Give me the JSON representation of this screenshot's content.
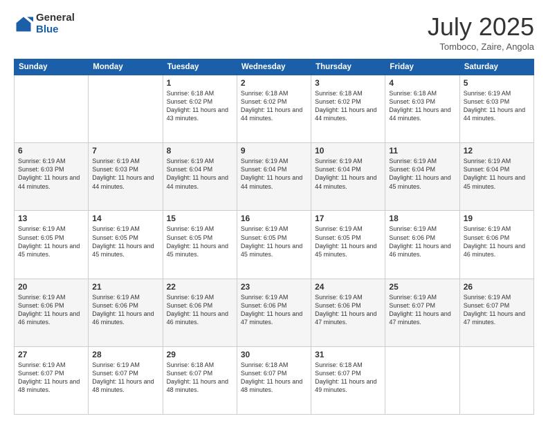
{
  "header": {
    "logo_general": "General",
    "logo_blue": "Blue",
    "month_title": "July 2025",
    "subtitle": "Tomboco, Zaire, Angola"
  },
  "days_of_week": [
    "Sunday",
    "Monday",
    "Tuesday",
    "Wednesday",
    "Thursday",
    "Friday",
    "Saturday"
  ],
  "weeks": [
    [
      {
        "num": "",
        "info": ""
      },
      {
        "num": "",
        "info": ""
      },
      {
        "num": "1",
        "info": "Sunrise: 6:18 AM\nSunset: 6:02 PM\nDaylight: 11 hours and 43 minutes."
      },
      {
        "num": "2",
        "info": "Sunrise: 6:18 AM\nSunset: 6:02 PM\nDaylight: 11 hours and 44 minutes."
      },
      {
        "num": "3",
        "info": "Sunrise: 6:18 AM\nSunset: 6:02 PM\nDaylight: 11 hours and 44 minutes."
      },
      {
        "num": "4",
        "info": "Sunrise: 6:18 AM\nSunset: 6:03 PM\nDaylight: 11 hours and 44 minutes."
      },
      {
        "num": "5",
        "info": "Sunrise: 6:19 AM\nSunset: 6:03 PM\nDaylight: 11 hours and 44 minutes."
      }
    ],
    [
      {
        "num": "6",
        "info": "Sunrise: 6:19 AM\nSunset: 6:03 PM\nDaylight: 11 hours and 44 minutes."
      },
      {
        "num": "7",
        "info": "Sunrise: 6:19 AM\nSunset: 6:03 PM\nDaylight: 11 hours and 44 minutes."
      },
      {
        "num": "8",
        "info": "Sunrise: 6:19 AM\nSunset: 6:04 PM\nDaylight: 11 hours and 44 minutes."
      },
      {
        "num": "9",
        "info": "Sunrise: 6:19 AM\nSunset: 6:04 PM\nDaylight: 11 hours and 44 minutes."
      },
      {
        "num": "10",
        "info": "Sunrise: 6:19 AM\nSunset: 6:04 PM\nDaylight: 11 hours and 44 minutes."
      },
      {
        "num": "11",
        "info": "Sunrise: 6:19 AM\nSunset: 6:04 PM\nDaylight: 11 hours and 45 minutes."
      },
      {
        "num": "12",
        "info": "Sunrise: 6:19 AM\nSunset: 6:04 PM\nDaylight: 11 hours and 45 minutes."
      }
    ],
    [
      {
        "num": "13",
        "info": "Sunrise: 6:19 AM\nSunset: 6:05 PM\nDaylight: 11 hours and 45 minutes."
      },
      {
        "num": "14",
        "info": "Sunrise: 6:19 AM\nSunset: 6:05 PM\nDaylight: 11 hours and 45 minutes."
      },
      {
        "num": "15",
        "info": "Sunrise: 6:19 AM\nSunset: 6:05 PM\nDaylight: 11 hours and 45 minutes."
      },
      {
        "num": "16",
        "info": "Sunrise: 6:19 AM\nSunset: 6:05 PM\nDaylight: 11 hours and 45 minutes."
      },
      {
        "num": "17",
        "info": "Sunrise: 6:19 AM\nSunset: 6:05 PM\nDaylight: 11 hours and 45 minutes."
      },
      {
        "num": "18",
        "info": "Sunrise: 6:19 AM\nSunset: 6:06 PM\nDaylight: 11 hours and 46 minutes."
      },
      {
        "num": "19",
        "info": "Sunrise: 6:19 AM\nSunset: 6:06 PM\nDaylight: 11 hours and 46 minutes."
      }
    ],
    [
      {
        "num": "20",
        "info": "Sunrise: 6:19 AM\nSunset: 6:06 PM\nDaylight: 11 hours and 46 minutes."
      },
      {
        "num": "21",
        "info": "Sunrise: 6:19 AM\nSunset: 6:06 PM\nDaylight: 11 hours and 46 minutes."
      },
      {
        "num": "22",
        "info": "Sunrise: 6:19 AM\nSunset: 6:06 PM\nDaylight: 11 hours and 46 minutes."
      },
      {
        "num": "23",
        "info": "Sunrise: 6:19 AM\nSunset: 6:06 PM\nDaylight: 11 hours and 47 minutes."
      },
      {
        "num": "24",
        "info": "Sunrise: 6:19 AM\nSunset: 6:06 PM\nDaylight: 11 hours and 47 minutes."
      },
      {
        "num": "25",
        "info": "Sunrise: 6:19 AM\nSunset: 6:07 PM\nDaylight: 11 hours and 47 minutes."
      },
      {
        "num": "26",
        "info": "Sunrise: 6:19 AM\nSunset: 6:07 PM\nDaylight: 11 hours and 47 minutes."
      }
    ],
    [
      {
        "num": "27",
        "info": "Sunrise: 6:19 AM\nSunset: 6:07 PM\nDaylight: 11 hours and 48 minutes."
      },
      {
        "num": "28",
        "info": "Sunrise: 6:19 AM\nSunset: 6:07 PM\nDaylight: 11 hours and 48 minutes."
      },
      {
        "num": "29",
        "info": "Sunrise: 6:18 AM\nSunset: 6:07 PM\nDaylight: 11 hours and 48 minutes."
      },
      {
        "num": "30",
        "info": "Sunrise: 6:18 AM\nSunset: 6:07 PM\nDaylight: 11 hours and 48 minutes."
      },
      {
        "num": "31",
        "info": "Sunrise: 6:18 AM\nSunset: 6:07 PM\nDaylight: 11 hours and 49 minutes."
      },
      {
        "num": "",
        "info": ""
      },
      {
        "num": "",
        "info": ""
      }
    ]
  ]
}
